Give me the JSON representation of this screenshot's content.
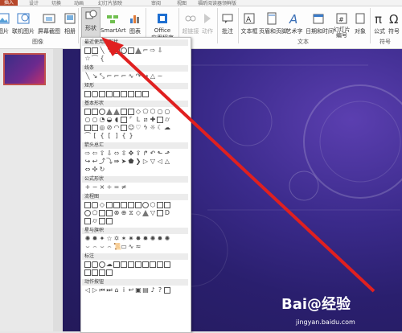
{
  "tabs": [
    "开始",
    "插入",
    "设计",
    "切换",
    "动画",
    "幻灯片放映",
    "审阅",
    "视图",
    "福昕阅读器领鲜版"
  ],
  "active_tab_index": 1,
  "ribbon": {
    "buttons": {
      "picture": "图片",
      "online_picture": "联机图片",
      "screenshot": "屏幕截图",
      "album": "相册",
      "shapes": "形状",
      "smartart": "SmartArt",
      "chart": "图表",
      "office_line1": "Office",
      "office_line2": "应用程序",
      "hyperlink": "超链接",
      "action": "动作",
      "comment": "批注",
      "textbox": "文本框",
      "header_footer": "页眉和页脚",
      "wordart": "艺术字",
      "datetime": "日期和时间",
      "slide_number": "幻灯片\n编号",
      "object": "对象",
      "equation": "公式",
      "symbol": "符号"
    },
    "groups": {
      "images": "图像",
      "text": "文本",
      "symbols": "符号"
    }
  },
  "shapes_menu": {
    "sections": [
      "最近使用的形状",
      "线条",
      "矩形",
      "基本形状",
      "箭头总汇",
      "公式形状",
      "流程图",
      "星与旗帜",
      "标注",
      "动作按钮"
    ]
  },
  "watermark": {
    "brand": "Bai@经验",
    "url": "jingyan.baidu.com"
  },
  "colors": {
    "accent": "#b7472a",
    "arrow": "#e02020",
    "slide_bg": "#2a1f6e"
  }
}
